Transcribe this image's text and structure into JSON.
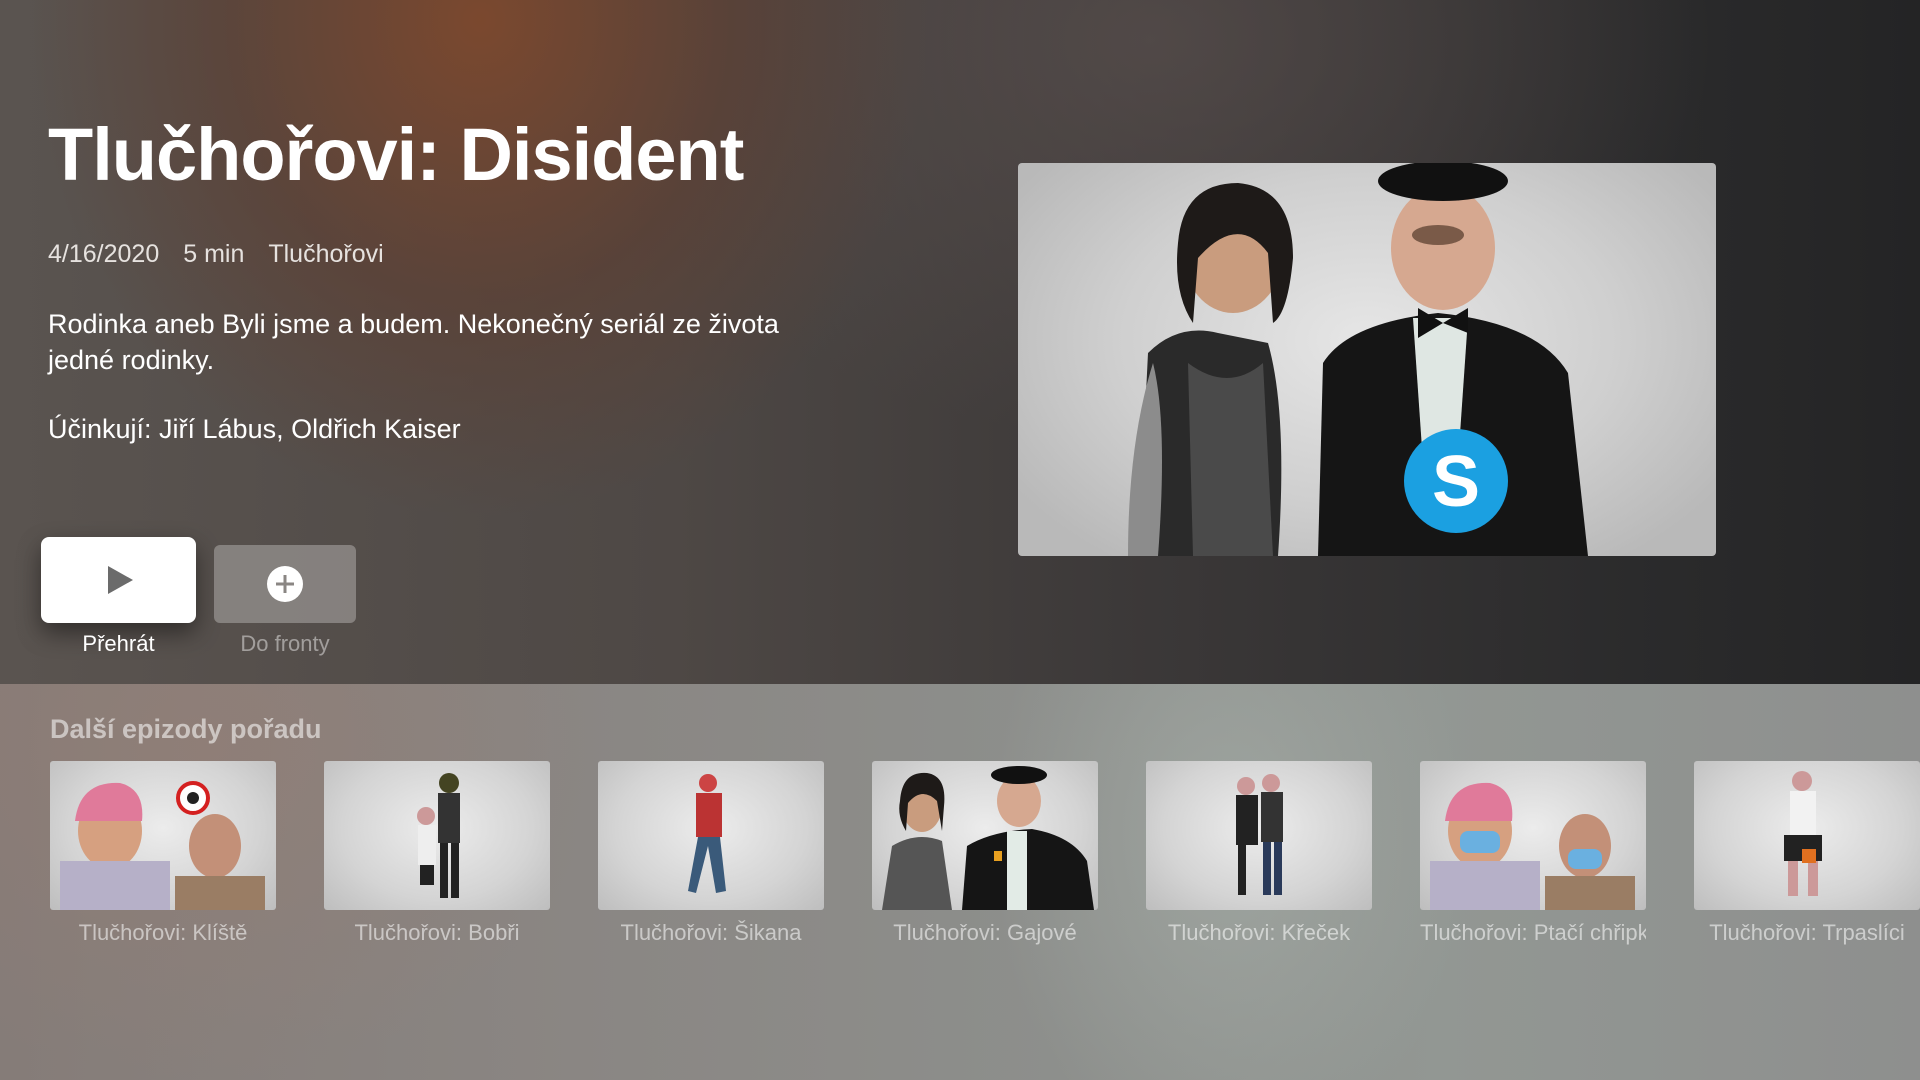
{
  "show": {
    "title": "Tlučhořovi: Disident",
    "date": "4/16/2020",
    "duration": "5 min",
    "series": "Tlučhořovi",
    "description": "Rodinka aneb Byli jsme a budem. Nekonečný seriál ze života jedné rodinky.",
    "cast": "Účinkují: Jiří Lábus, Oldřich Kaiser"
  },
  "actions": {
    "play_label": "Přehrát",
    "queue_label": "Do fronty"
  },
  "episodes_section": {
    "title": "Další epizody pořadu",
    "items": [
      {
        "label": "Tlučhořovi: Klíště"
      },
      {
        "label": "Tlučhořovi: Bobři"
      },
      {
        "label": "Tlučhořovi: Šikana"
      },
      {
        "label": "Tlučhořovi: Gajové"
      },
      {
        "label": "Tlučhořovi: Křeček"
      },
      {
        "label": "Tlučhořovi: Ptačí chřipka"
      },
      {
        "label": "Tlučhořovi: Trpaslíci"
      }
    ]
  },
  "colors": {
    "skype_blue": "#1ba0e1",
    "tick_red": "#d42020"
  }
}
